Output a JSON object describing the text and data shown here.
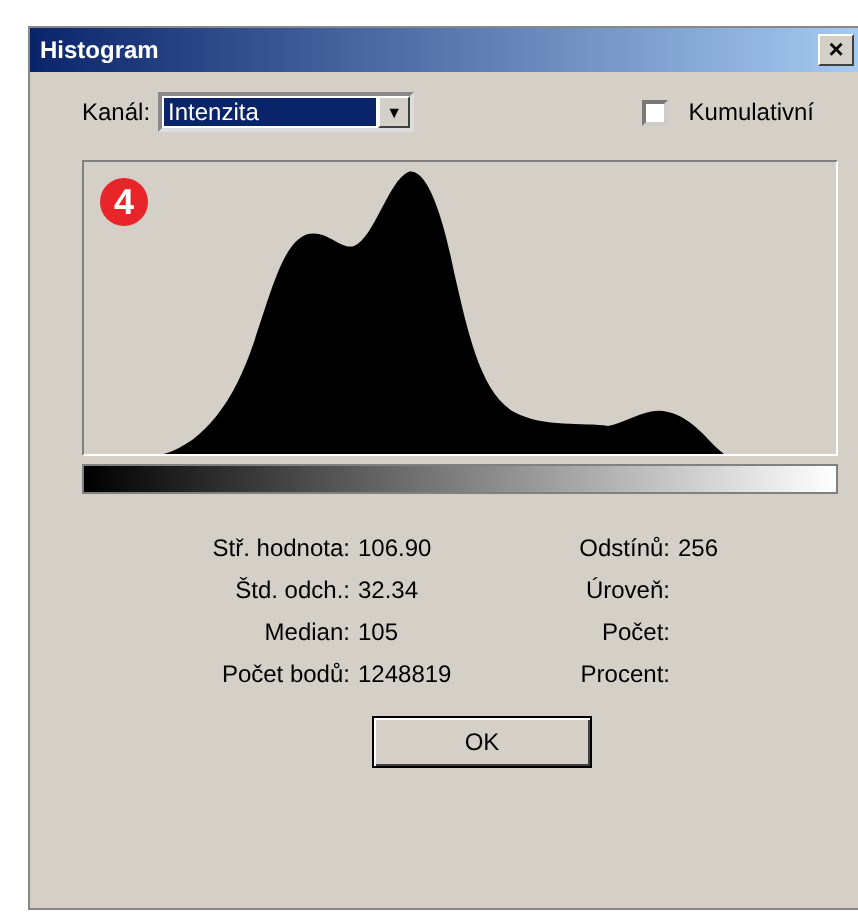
{
  "window": {
    "title": "Histogram",
    "close": "×"
  },
  "channel": {
    "label": "Kanál:",
    "value": "Intenzita",
    "arrow": "▼"
  },
  "cumulative": {
    "label": "Kumulativní",
    "checked": false
  },
  "callout": "4",
  "stats_left": [
    {
      "label": "Stř. hodnota:",
      "value": "106.90"
    },
    {
      "label": "Štd. odch.:",
      "value": "32.34"
    },
    {
      "label": "Median:",
      "value": "105"
    },
    {
      "label": "Počet bodů:",
      "value": "1248819"
    }
  ],
  "stats_right": [
    {
      "label": "Odstínů:",
      "value": "256"
    },
    {
      "label": "Úroveň:"
    },
    {
      "label": "Počet:"
    },
    {
      "label": "Procent:"
    }
  ],
  "buttons": [
    "OK"
  ]
}
